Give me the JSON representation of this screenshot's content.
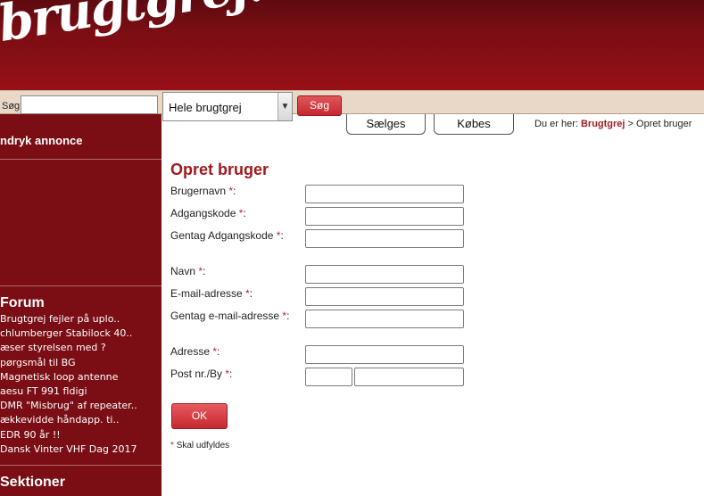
{
  "header": {
    "logo_text": "brugtgrej.dk"
  },
  "search": {
    "label": "Søg",
    "value": "",
    "scope_selected": "Hele brugtgrej",
    "button_label": "Søg"
  },
  "sidebar": {
    "top_item": "ndryk annonce",
    "forum_title": "Forum",
    "forum_items": [
      "Brugtgrej fejler på uplo..",
      "chlumberger Stabilock 40..",
      "æser styrelsen med ?",
      "pørgsmål til BG",
      "Magnetisk loop antenne",
      "aesu FT 991 fldigi",
      "DMR \"Misbrug\" af repeater..",
      "ækkevidde håndapp. ti..",
      "EDR 90 år !!",
      "Dansk Vinter VHF Dag 2017"
    ],
    "sektioner_title": "Sektioner"
  },
  "tabs": {
    "saelges": "Sælges",
    "kobes": "Købes"
  },
  "breadcrumb": {
    "prefix": "Du er her:",
    "root": "Brugtgrej",
    "separator": ">",
    "current": "Opret bruger"
  },
  "form": {
    "title": "Opret bruger",
    "required_mark": "*",
    "colon": ":",
    "fields": {
      "username": {
        "label": "Brugernavn",
        "value": ""
      },
      "password": {
        "label": "Adgangskode",
        "value": ""
      },
      "password_repeat": {
        "label": "Gentag Adgangskode",
        "value": ""
      },
      "name": {
        "label": "Navn",
        "value": ""
      },
      "email": {
        "label": "E-mail-adresse",
        "value": ""
      },
      "email_repeat": {
        "label": "Gentag e-mail-adresse",
        "value": ""
      },
      "address": {
        "label": "Adresse",
        "value": ""
      },
      "postal_city": {
        "label": "Post nr./By",
        "postal_value": "",
        "city_value": ""
      }
    },
    "ok_label": "OK",
    "required_note_mark": "*",
    "required_note_text": "Skal udfyldes"
  },
  "colors": {
    "brand_dark": "#7a0e14",
    "brand_red": "#c42a30",
    "accent_text": "#a0191c",
    "bar_beige": "#e9d8c8"
  }
}
